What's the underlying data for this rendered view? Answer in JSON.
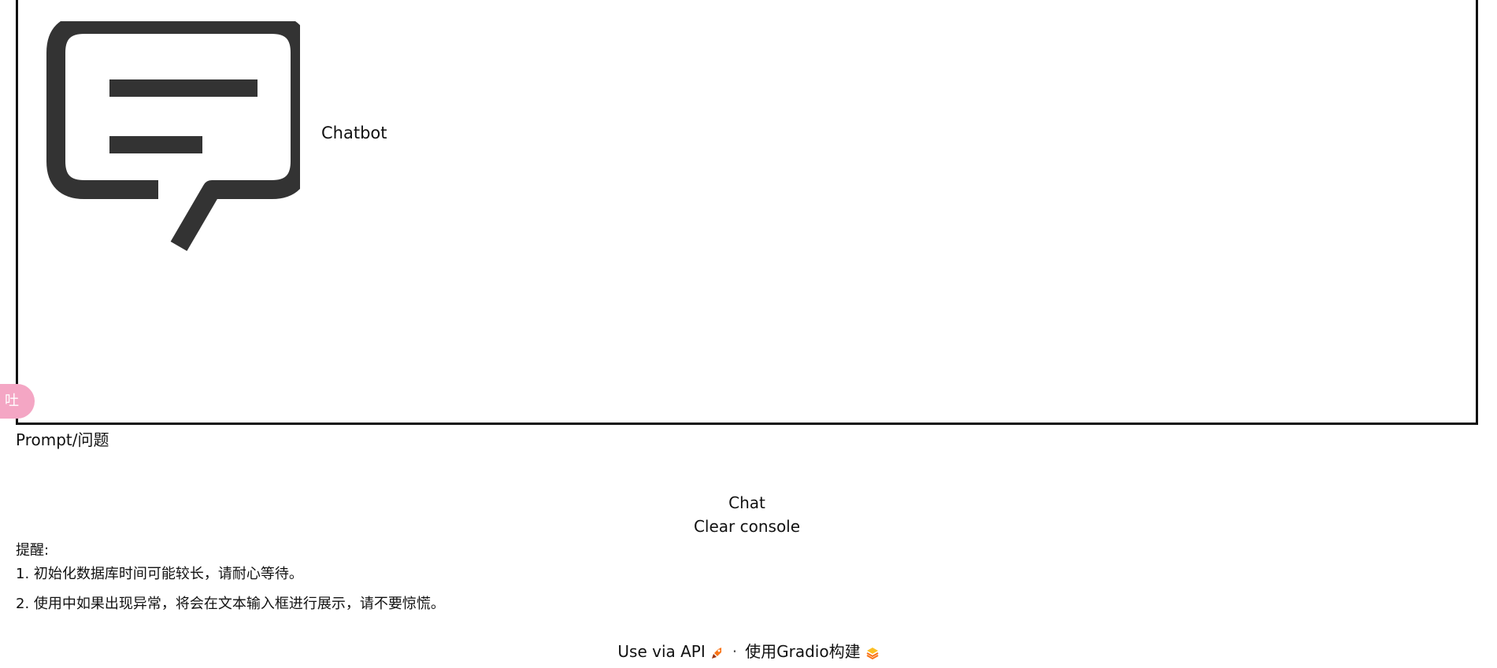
{
  "chatbot": {
    "label": "Chatbot",
    "icon": "chat-bubble-icon"
  },
  "floating_badge": {
    "text": "吐",
    "color": "#f4a6c4"
  },
  "prompt": {
    "label": "Prompt/问题"
  },
  "buttons": {
    "chat": "Chat",
    "clear_console": "Clear console"
  },
  "notes": {
    "title": "提醒:",
    "items": [
      "1. 初始化数据库时间可能较长，请耐心等待。",
      "2. 使用中如果出现异常，将会在文本输入框进行展示，请不要惊慌。"
    ]
  },
  "footer": {
    "api_link": "Use via API",
    "separator": "·",
    "built_with": "使用Gradio构建",
    "accent_color": "#f97316"
  }
}
